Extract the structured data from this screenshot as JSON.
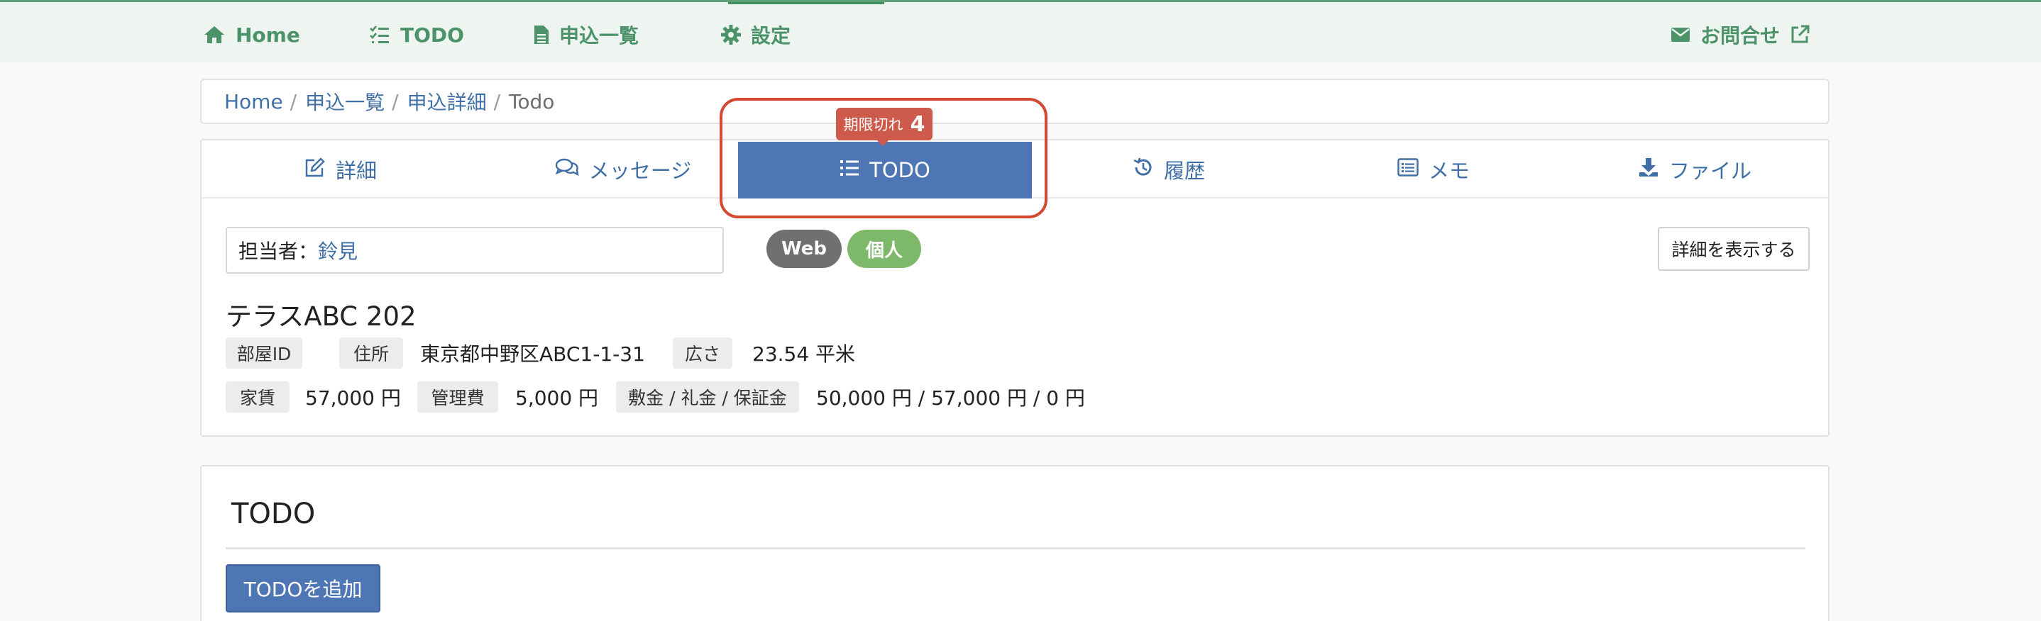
{
  "nav": {
    "home": "Home",
    "todo": "TODO",
    "applications": "申込一覧",
    "settings": "設定",
    "contact": "お問合せ"
  },
  "breadcrumb": [
    "Home",
    "申込一覧",
    "申込詳細",
    "Todo"
  ],
  "tabs": [
    "詳細",
    "メッセージ",
    "TODO",
    "履歴",
    "メモ",
    "ファイル"
  ],
  "active_tab": "TODO",
  "expired_badge": {
    "label": "期限切れ",
    "count": "4"
  },
  "assignee": {
    "label": "担当者：",
    "value": "鈴見"
  },
  "pills": {
    "channel": "Web",
    "type": "個人"
  },
  "show_details_label": "詳細を表示する",
  "property": {
    "title": "テラスABC 202",
    "room_id_label": "部屋ID",
    "address_label": "住所",
    "address": "東京都中野区ABC1-1-31",
    "area_label": "広さ",
    "area": "23.54 平米",
    "rent_label": "家賃",
    "rent": "57,000 円",
    "mgmt_fee_label": "管理費",
    "mgmt_fee": "5,000 円",
    "deposit_label": "敷金 / 礼金 / 保証金",
    "deposit": "50,000 円 / 57,000 円 / 0 円"
  },
  "todo_section": {
    "heading": "TODO",
    "add_button": "TODOを追加"
  },
  "colors": {
    "nav_green": "#4d9369",
    "link_blue": "#3f6fa6",
    "primary": "#4f76b4",
    "alert_red": "#d24a33",
    "pill_gray": "#707070",
    "pill_green": "#7eb86b"
  }
}
